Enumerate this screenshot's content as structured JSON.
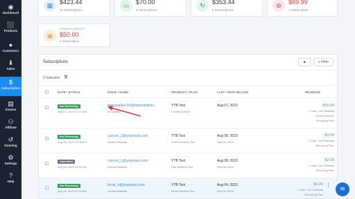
{
  "sidebar": {
    "items": [
      {
        "label": "Dashboard",
        "icon": "dashboard-icon"
      },
      {
        "label": "Products",
        "icon": "products-icon"
      },
      {
        "label": "Customers",
        "icon": "customers-icon"
      },
      {
        "label": "Sales",
        "icon": "sales-icon"
      },
      {
        "label": "Subscription",
        "icon": "subscription-icon",
        "active": true
      },
      {
        "label": "Invoice",
        "icon": "invoice-icon"
      },
      {
        "label": "Affiliate",
        "icon": "affiliate-icon"
      },
      {
        "label": "Dunning",
        "icon": "dunning-icon"
      },
      {
        "label": "Settings",
        "icon": "settings-icon"
      },
      {
        "label": "Help",
        "icon": "help-icon"
      }
    ]
  },
  "stats": [
    {
      "amount": "$423.44",
      "subtitle": "11 Subscriptions"
    },
    {
      "amount": "$70.00",
      "subtitle": "3 Subscriptions"
    },
    {
      "amount": "$353.44",
      "subtitle": "8 Subscriptions"
    },
    {
      "amount": "$69.99",
      "subtitle": "1 Subscription"
    },
    {
      "label": "PENDING AMOUNT",
      "amount": "$50.00",
      "subtitle": "1 Subscription"
    }
  ],
  "subscriptions": {
    "title": "Subscriptions",
    "filter_label": "Filter",
    "selected_text": "0 Selected",
    "columns": {
      "date_status": "DATE / STATUS",
      "email_name": "EMAIL / NAME",
      "product_plan": "PRODUCT / PLAN",
      "last_next_billing": "LAST / NEXT BILLING",
      "revenue": "REVENUE"
    },
    "rows": [
      {
        "status": "Not Renewing",
        "date": "Aug 07, 2023 07:13 AM",
        "email": "berrysadio-36@mbookitem...",
        "name": "not prabby",
        "product": "YTB Test",
        "plan": "Credits 110000",
        "last_billing": "Aug 07, 2023",
        "next_billing": "",
        "revenue": "$50.00",
        "revenue_detail_1": "1 Sale • 1st Gateway",
        "revenue_detail_2": "Cancel Recurre",
        "revenue_detail_3": "Recurring Plan"
      },
      {
        "status": "Not Renewing",
        "date": "Aug 08, 2023 10:05 AM",
        "email": "cancel_2@yopmail.com",
        "name": "Ashwin Baradar",
        "product": "YTB Test",
        "plan": "Acem Monthly Test",
        "last_billing": "Aug 08, 2023",
        "next_billing": "Sep 08, 2023",
        "revenue": "$9.99",
        "revenue_detail_1": "1 Sale • 1st Gateway",
        "revenue_detail_2": "Recurring Plan",
        "revenue_detail_3": ""
      },
      {
        "status": "Cancelled",
        "date": "Aug 08, 2023 09:33 AM",
        "email": "cancel_1@yopmail.com",
        "name": "Ashwin Baradar",
        "product": "YTB Test",
        "plan": "Oak Monthly Test",
        "last_billing": "Aug 08, 2023",
        "next_billing": "Sep 08, 2023",
        "revenue": "$9.99",
        "revenue_detail_1": "1 Sale • 1st Gateway",
        "revenue_detail_2": "Recurring Plan",
        "revenue_detail_3": ""
      },
      {
        "status": "Not Renewing",
        "date": "Aug 04, 2023 07:13 AM",
        "email": "local_4@yopmail.com",
        "name": "Ashwin Baradar",
        "product": "YTB Test",
        "plan": "Acem Monthly Test",
        "last_billing": "Aug 04, 2023",
        "next_billing": "Sep 04, 2023",
        "revenue": "$9.99",
        "revenue_detail_1": "1 Sale • 1st Gateway",
        "revenue_detail_2": "Recurring Plan",
        "revenue_detail_3": ""
      }
    ]
  },
  "colors": {
    "accent": "#1b8df0",
    "sidebar_bg": "#1c2330",
    "badge_not_renewing": "#2e9e5b",
    "badge_cancelled": "#6b7280",
    "arrow": "#e53935"
  }
}
